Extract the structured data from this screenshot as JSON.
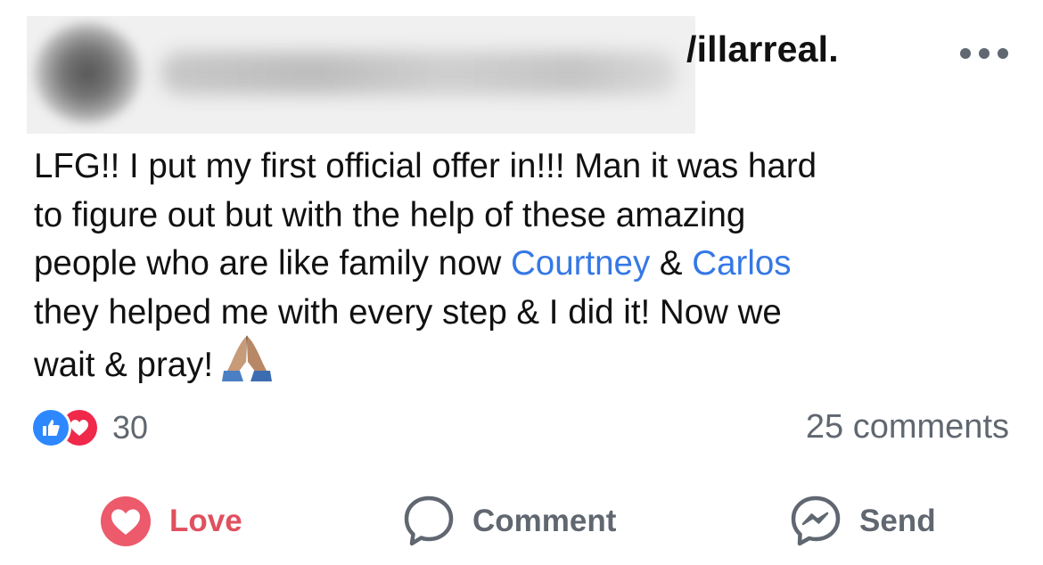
{
  "header": {
    "name_visible": "/illarreal.",
    "more_icon": "more-dots-icon"
  },
  "post": {
    "line1": "LFG!! I put my first official offer in!!! Man it was hard",
    "line2": "to figure out but with the help of these amazing",
    "line3_pre": "people who are like family now ",
    "mention1": "Courtney",
    "line3_mid": " & ",
    "mention2": "Carlos",
    "line4": "they helped me with every step & I did it! Now we",
    "line5": "wait & pray!",
    "emoji": "folded-hands-icon"
  },
  "reactions": {
    "types": [
      "like-icon",
      "love-icon"
    ],
    "count": "30",
    "comments": "25 comments"
  },
  "actions": {
    "love": "Love",
    "comment": "Comment",
    "send": "Send"
  },
  "colors": {
    "link": "#3578e5",
    "love": "#e0505e",
    "like_badge": "#2d88ff",
    "love_badge": "#f0284a",
    "secondary_text": "#606770"
  }
}
